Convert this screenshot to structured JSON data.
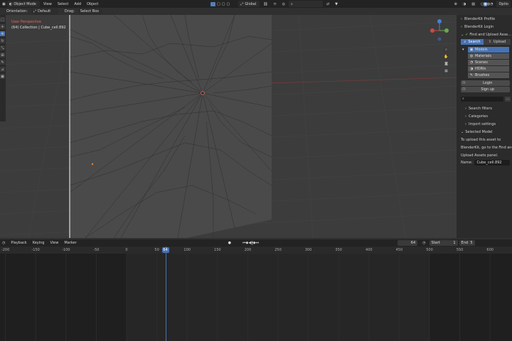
{
  "header": {
    "mode": "Object Mode",
    "menus": [
      "View",
      "Select",
      "Add",
      "Object"
    ],
    "orientation_transform": "Global",
    "search_placeholder": "",
    "right_label": "Optio"
  },
  "tool_header": {
    "orientation_label": "Orientation:",
    "orientation_value": "Default",
    "drag_label": "Drag:",
    "drag_value": "Select Box"
  },
  "viewport": {
    "overlay_line1": "User Perspective",
    "overlay_line2": "(64) Collection | Cube_cell.892"
  },
  "sidebar": {
    "profile": "BlenderKit Profile",
    "login": "BlenderKit Login",
    "find_upload": "Find and Upload Asse...",
    "search_tab": "Search",
    "upload_tab": "Upload",
    "asset_types": [
      {
        "label": "Models",
        "active": true
      },
      {
        "label": "Materials",
        "active": false
      },
      {
        "label": "Scenes",
        "active": false
      },
      {
        "label": "HDRIs",
        "active": false
      },
      {
        "label": "Brushes",
        "active": false
      }
    ],
    "login_button": "Login",
    "signup_button": "Sign up",
    "search_filters": "Search filters",
    "categories": "Categories",
    "import_settings": "Import settings",
    "selected_model": "Selected Model",
    "info_line1": "To upload this asset to",
    "info_line2": "BlenderKit, go to the Find and",
    "info_line3": "Upload Assets panel.",
    "name_label": "Name:",
    "name_value": "Cube_cell.892"
  },
  "timeline": {
    "menus": [
      "Playback",
      "Keying",
      "View",
      "Marker"
    ],
    "current_frame": "64",
    "start_label": "Start",
    "start_value": "1",
    "end_label": "End",
    "end_value": "5",
    "ruler": [
      {
        "label": "-200",
        "value": -200
      },
      {
        "label": "-150",
        "value": -150
      },
      {
        "label": "-100",
        "value": -100
      },
      {
        "label": "-50",
        "value": -50
      },
      {
        "label": "0",
        "value": 0
      },
      {
        "label": "50",
        "value": 50
      },
      {
        "label": "100",
        "value": 100
      },
      {
        "label": "150",
        "value": 150
      },
      {
        "label": "200",
        "value": 200
      },
      {
        "label": "250",
        "value": 250
      },
      {
        "label": "300",
        "value": 300
      },
      {
        "label": "350",
        "value": 350
      },
      {
        "label": "400",
        "value": 400
      },
      {
        "label": "450",
        "value": 450
      },
      {
        "label": "500",
        "value": 500
      },
      {
        "label": "550",
        "value": 550
      },
      {
        "label": "600",
        "value": 600
      }
    ],
    "playhead_label": "64"
  },
  "colors": {
    "accent": "#4772b3",
    "overlay_red": "#e06b5a",
    "axis_red": "#b03a3a",
    "axis_green": "#6aa84f"
  }
}
